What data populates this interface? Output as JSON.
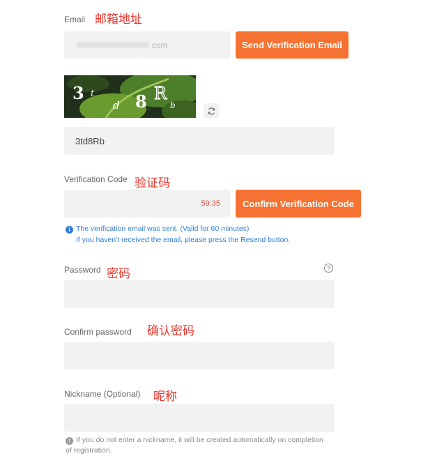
{
  "email": {
    "label": "Email",
    "annotation": "邮箱地址",
    "value_suffix": "com",
    "send_button": "Send Verification Email"
  },
  "captcha": {
    "image_text": "3td8Rb",
    "refresh_icon": "refresh-icon",
    "input_value": "3td8Rb"
  },
  "verification": {
    "label": "Verification Code",
    "annotation": "验证码",
    "timer": "59:35",
    "confirm_button": "Confirm Verification Code",
    "info_icon": "info-icon",
    "info_line1": "The verification email was sent. (Valid for 60 minutes)",
    "info_line2": "If you haven't received the email, please press the Resend button."
  },
  "password": {
    "label": "Password",
    "annotation": "密码",
    "help_icon": "question-icon"
  },
  "confirm_password": {
    "label": "Confirm password",
    "annotation": "确认密码"
  },
  "nickname": {
    "label": "Nickname (Optional)",
    "annotation": "昵称",
    "hint_icon": "info-icon",
    "hint_line1": "If you do not enter a nickname, it will be created automatically on completion",
    "hint_line2": "of registration."
  },
  "colors": {
    "accent": "#f57232",
    "annotation": "#e8342a",
    "info": "#2f7ed8",
    "field_bg": "#f2f2f2"
  }
}
